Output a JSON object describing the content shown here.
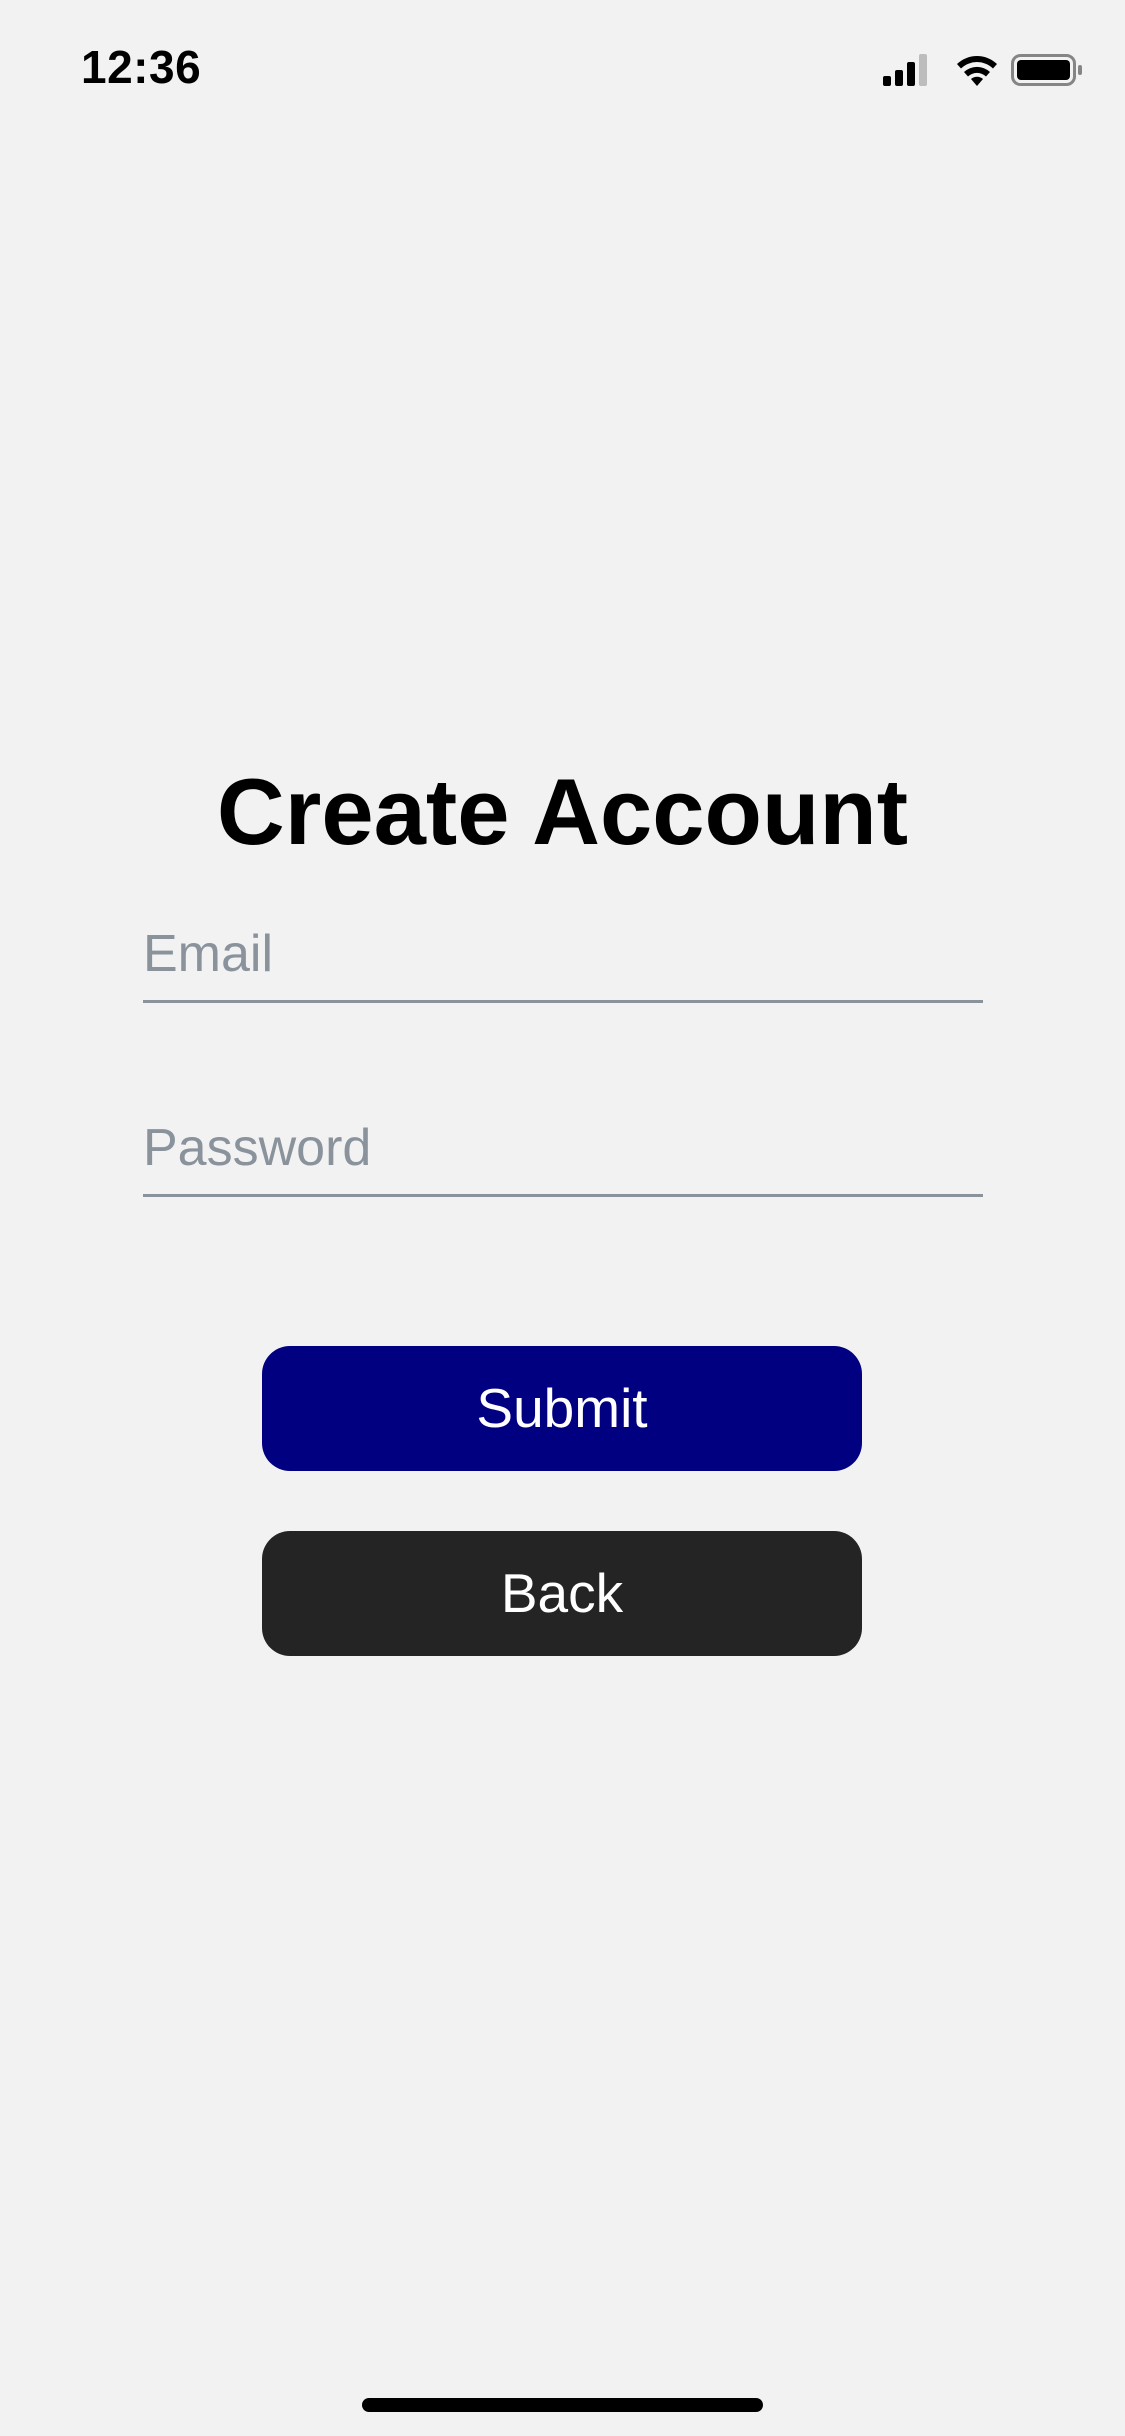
{
  "status_bar": {
    "time": "12:36",
    "icons": [
      "cellular-signal-icon",
      "wifi-icon",
      "battery-icon"
    ]
  },
  "form": {
    "title": "Create Account",
    "email_placeholder": "Email",
    "email_value": "",
    "password_placeholder": "Password",
    "password_value": "",
    "submit_label": "Submit",
    "back_label": "Back"
  },
  "colors": {
    "background": "#f2f2f2",
    "submit_button": "#000080",
    "back_button": "#242424",
    "placeholder": "#8a939c"
  }
}
